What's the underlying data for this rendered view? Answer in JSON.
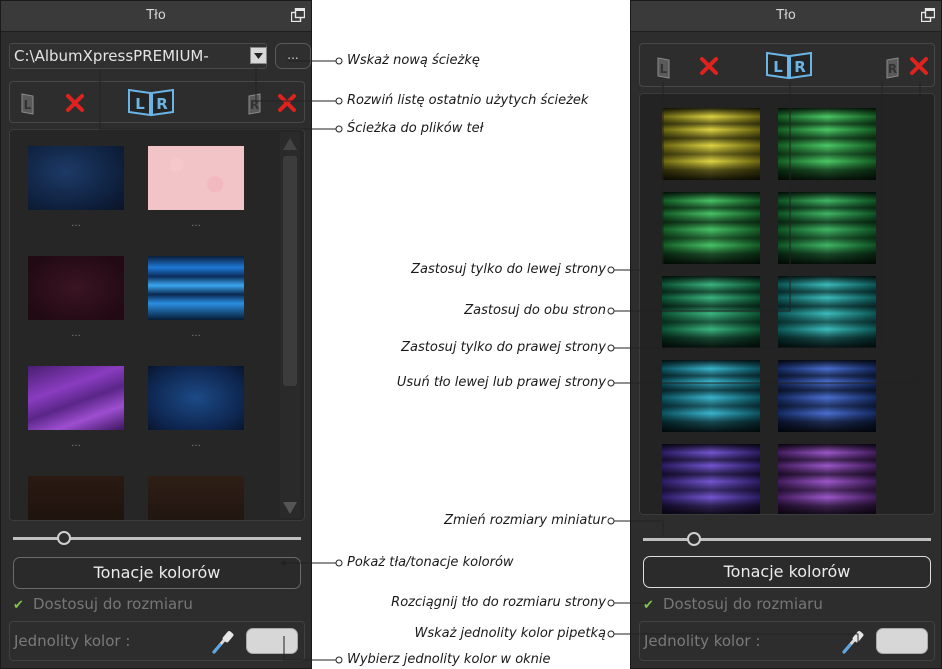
{
  "left_panel": {
    "title": "Tło",
    "path_value": "C:\\AlbumXpressPREMIUM-",
    "browse_label": "...",
    "tone_button_label": "Tonacje kolorów",
    "fit_label": "Dostosuj do rozmiaru",
    "solid_color_label": "Jednolity kolor :",
    "thumbnail_caption": "...",
    "thumbnails": [
      {
        "kind": "dark-blue-grunge"
      },
      {
        "kind": "pink-floral"
      },
      {
        "kind": "maroon-texture"
      },
      {
        "kind": "blue-light-streaks"
      },
      {
        "kind": "purple-silk"
      },
      {
        "kind": "blue-bokeh"
      },
      {
        "kind": "brown-dark"
      },
      {
        "kind": "brown-dark"
      }
    ]
  },
  "right_panel": {
    "title": "Tło",
    "tone_button_label": "Tonacje kolorów",
    "fit_label": "Dostosuj do rozmiaru",
    "solid_color_label": "Jednolity kolor :",
    "swatches": [
      {
        "color": "#d8cc22"
      },
      {
        "color": "#2bbf4a"
      },
      {
        "color": "#28b84c"
      },
      {
        "color": "#1fa94a"
      },
      {
        "color": "#19a86a"
      },
      {
        "color": "#1ab0b0"
      },
      {
        "color": "#18a8c4"
      },
      {
        "color": "#2a55c8"
      },
      {
        "color": "#5a38c8"
      },
      {
        "color": "#8a3ac0"
      }
    ]
  },
  "apply_buttons": {
    "left": "L",
    "right": "R"
  },
  "colors": {
    "delete_x": "#e0221e",
    "lr_blue": "#6ab4e6",
    "check_green": "#7ec44a"
  },
  "icons": [
    "restore-icon",
    "dropdown-arrow-icon",
    "book-left-icon",
    "book-both-icon",
    "book-right-icon",
    "delete-icon",
    "pipette-icon",
    "checkmark-icon"
  ],
  "callouts": {
    "new_path": "Wskaż nową ścieżkę",
    "recent_paths": "Rozwiń listę ostatnio użytych ścieżek",
    "bg_path": "Ścieżka do plików teł",
    "left_only": "Zastosuj tylko do lewej strony",
    "both": "Zastosuj do obu stron",
    "right_only": "Zastosuj tylko do prawej strony",
    "remove": "Usuń tło lewej lub prawej strony",
    "resize": "Zmień rozmiary miniatur",
    "show_tones": "Pokaż tła/tonacje kolorów",
    "stretch": "Rozciągnij tło do rozmiaru strony",
    "pipette": "Wskaż jednolity kolor pipetką",
    "window_color": "Wybierz jednolity kolor w oknie"
  }
}
